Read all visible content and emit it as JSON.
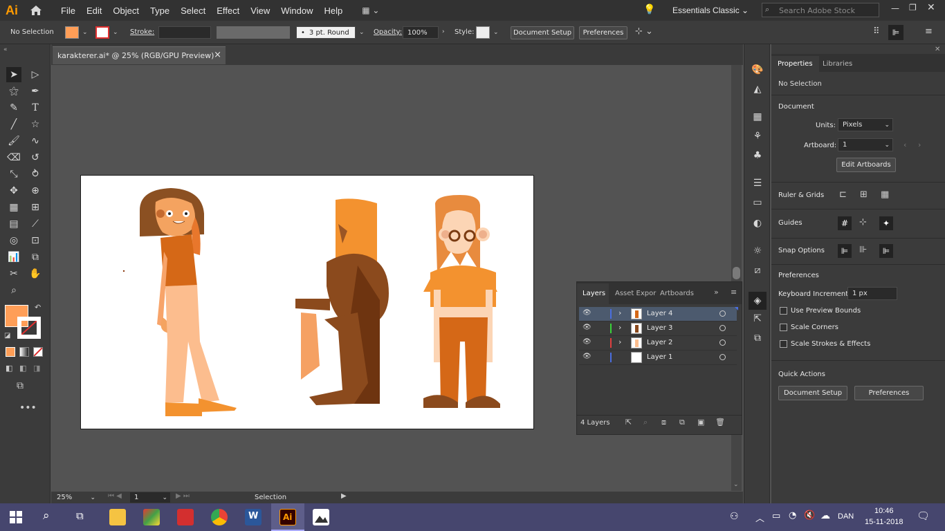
{
  "app": {
    "logo": "Ai"
  },
  "menu": [
    "File",
    "Edit",
    "Object",
    "Type",
    "Select",
    "Effect",
    "View",
    "Window",
    "Help"
  ],
  "workspace": "Essentials Classic",
  "search": {
    "placeholder": "Search Adobe Stock"
  },
  "control": {
    "selection": "No Selection",
    "stroke_label": "Stroke:",
    "brush": "3 pt. Round",
    "opacity_label": "Opacity:",
    "opacity_value": "100%",
    "style_label": "Style:",
    "document_setup": "Document Setup",
    "preferences": "Preferences"
  },
  "document_tab": {
    "title": "karakterer.ai* @ 25% (RGB/GPU Preview)",
    "close": "×"
  },
  "properties": {
    "tabs": [
      "Properties",
      "Libraries"
    ],
    "selection": "No Selection",
    "document_title": "Document",
    "units_label": "Units:",
    "units_value": "Pixels",
    "artboard_label": "Artboard:",
    "artboard_value": "1",
    "edit_artboards": "Edit Artboards",
    "ruler_grids": "Ruler & Grids",
    "guides": "Guides",
    "snap_options": "Snap Options",
    "preferences_title": "Preferences",
    "keyboard_increment_label": "Keyboard Increment:",
    "keyboard_increment_value": "1 px",
    "checkboxes": [
      "Use Preview Bounds",
      "Scale Corners",
      "Scale Strokes & Effects"
    ],
    "quick_actions": "Quick Actions",
    "qa_document_setup": "Document Setup",
    "qa_preferences": "Preferences"
  },
  "layers_panel": {
    "tabs": [
      "Layers",
      "Asset Expor",
      "Artboards"
    ],
    "layers": [
      {
        "name": "Layer 4",
        "color": "#4a6ee0",
        "selected": true
      },
      {
        "name": "Layer 3",
        "color": "#3ad33a",
        "selected": false
      },
      {
        "name": "Layer 2",
        "color": "#e04040",
        "selected": false
      },
      {
        "name": "Layer 1",
        "color": "#4a6ee0",
        "selected": false
      }
    ],
    "count": "4 Layers"
  },
  "status": {
    "zoom": "25%",
    "artboard": "1",
    "tool": "Selection"
  },
  "taskbar": {
    "lang": "DAN",
    "time": "10:46",
    "date": "15-11-2018"
  },
  "colors": {
    "fill": "#ff9e57",
    "accent": "#ff9a00"
  }
}
